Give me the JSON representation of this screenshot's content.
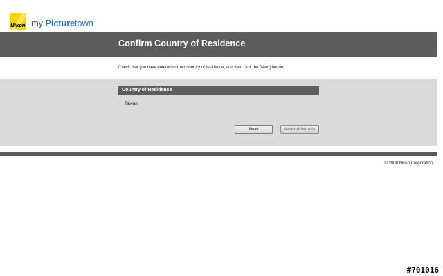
{
  "header": {
    "logo_text": "Nikon",
    "brand_prefix": "my ",
    "brand_mid": "Picture",
    "brand_suffix": "town",
    "brand_color": "#2a78c2",
    "logo_color": "#f7d500"
  },
  "page": {
    "title": "Confirm Country of Residence",
    "instruction": "Check that you have entered correct country of residence, and then click the [Next] button."
  },
  "section": {
    "header": "Country of Residence",
    "value": "Taiwan"
  },
  "buttons": {
    "next_label": "Next",
    "amend_label": "Amend Details"
  },
  "footer": {
    "copyright": "© 2008 Nikon Corporation"
  },
  "overlay": {
    "id_tag": "#701016"
  }
}
